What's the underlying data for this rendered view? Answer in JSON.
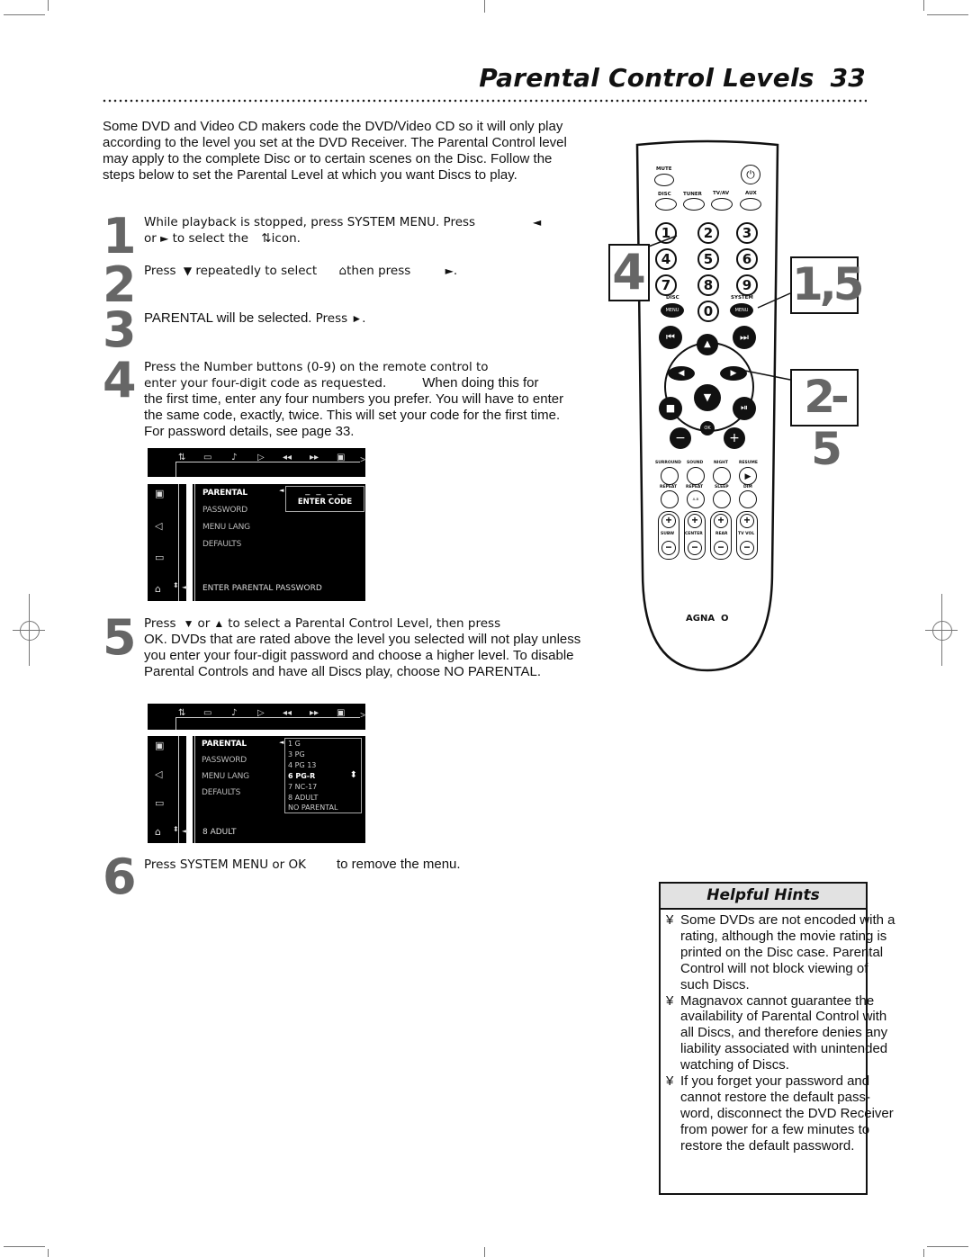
{
  "header": {
    "title": "Parental Control Levels",
    "page_number": "33"
  },
  "intro": "Some DVD and Video CD makers code the DVD/Video CD so it will only play according to the level you set at the DVD Receiver. The Parental Control level may apply to the complete Disc or to certain scenes on the Disc. Follow the steps below to set the Parental Level at which you want Discs to play.",
  "steps": [
    {
      "num": "1",
      "line1": "While playback is stopped, press SYSTEM MENU. Press",
      "arrow_left": "◄",
      "line2a": "or",
      "arrow_right": "►",
      "line2b": "to select the",
      "icon": "⇅",
      "line2c": "icon."
    },
    {
      "num": "2",
      "a": "Press",
      "down": "▼",
      "b": "repeatedly to select",
      "icon": "⌂",
      "c": "then press",
      "right": "►",
      "d": "."
    },
    {
      "num": "3",
      "a": "PARENTAL will be selected.",
      "b": "Press",
      "right": "►",
      "c": "."
    },
    {
      "num": "4",
      "line1": "Press the Number buttons (0-9) on the remote control to",
      "line2a": "enter your four-digit code as requested.",
      "line2b": "When doing this for",
      "rest": "the first time, enter any four numbers you prefer. You will have to enter the same code, exactly, twice. This will set your code for the first time. For password details, see page 33."
    },
    {
      "num": "5",
      "a": "Press",
      "down": "▼",
      "or": "or",
      "up": "▲",
      "b": "to select a Parental Control Level, then press",
      "rest": "OK. DVDs that are rated above the level you selected will not play unless you enter your four-digit password and choose a higher level. To disable Parental Controls and have all Discs play, choose NO PARENTAL."
    },
    {
      "num": "6",
      "a": "Press SYSTEM MENU or OK",
      "b": "to remove the menu."
    }
  ],
  "osd1": {
    "top_icons": [
      "settings-icon",
      "subtitle-icon",
      "audio-icon",
      "play-icon",
      "rewind-icon",
      "fast-forward-icon",
      "display-icon"
    ],
    "top_glyphs": [
      "⇅",
      "▭",
      "♪",
      "▷",
      "◂◂",
      "▸▸",
      "▣"
    ],
    "left_glyphs": [
      "▣",
      "◁",
      "▭",
      "⌂"
    ],
    "menu": [
      "PARENTAL",
      "PASSWORD",
      "MENU LANG",
      "DEFAULTS"
    ],
    "code_dashes": "_ _ _ _",
    "code_label": "ENTER CODE",
    "status": "ENTER PARENTAL PASSWORD"
  },
  "osd2": {
    "top_glyphs": [
      "⇅",
      "▭",
      "♪",
      "▷",
      "◂◂",
      "▸▸",
      "▣"
    ],
    "left_glyphs": [
      "▣",
      "◁",
      "▭",
      "⌂"
    ],
    "menu": [
      "PARENTAL",
      "PASSWORD",
      "MENU LANG",
      "DEFAULTS"
    ],
    "levels": [
      "1 G",
      "3 PG",
      "4 PG 13",
      "6 PG-R",
      "7 NC-17",
      "8 ADULT",
      "NO PARENTAL"
    ],
    "selected_level": "6 PG-R",
    "status": "8 ADULT"
  },
  "remote": {
    "top_labels": {
      "mute": "MUTE",
      "disc": "DISC",
      "tuner": "TUNER",
      "tvav": "TV/AV",
      "aux": "AUX"
    },
    "numbers": [
      "1",
      "2",
      "3",
      "4",
      "5",
      "6",
      "7",
      "8",
      "9",
      "0"
    ],
    "disc_label": "DISC",
    "system_label": "SYSTEM",
    "menu_label": "MENU",
    "ok_label": "OK",
    "row1": [
      "SURROUND",
      "SOUND",
      "NIGHT",
      "RESUME"
    ],
    "row2": [
      "REPEAT",
      "REPEAT",
      "SLEEP",
      "DIM"
    ],
    "ab_label": "A-B",
    "vol_labels": [
      "SUBW",
      "CENTER",
      "REAR",
      "TV VOL"
    ],
    "brand": "AGNA  O",
    "callouts": {
      "left": "4",
      "right_top": "1,5",
      "right_mid": "2-5"
    }
  },
  "hints": {
    "title": "Helpful Hints",
    "bullet": "¥",
    "items": [
      "Some DVDs are not encoded with a rating, although the movie rating is printed on the Disc case. Parental Control will not block viewing of such Discs.",
      "Magnavox cannot guarantee the availability of Parental Control with all Discs, and therefore denies any liability associated with unintended watching of Discs.",
      "If you forget your password and cannot restore the default pass- word, disconnect the DVD Receiver from power for a few minutes to restore the default password."
    ]
  }
}
